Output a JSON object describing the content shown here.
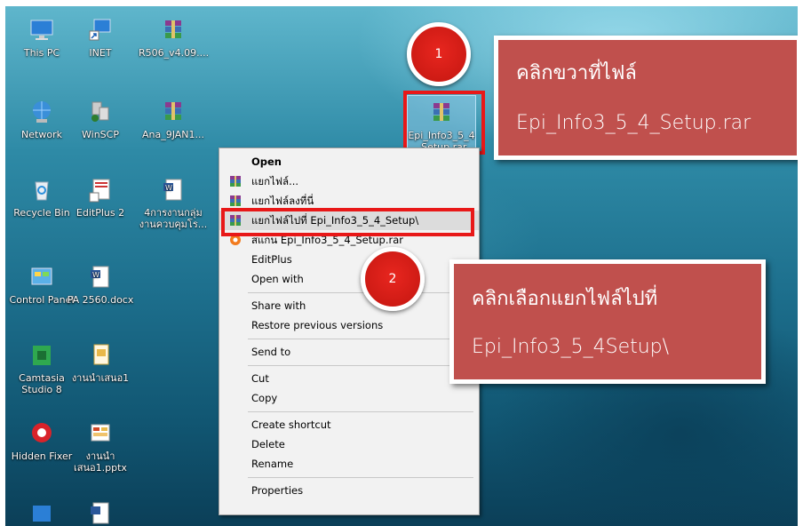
{
  "desktop": {
    "icons": [
      {
        "label": "This PC",
        "icon": "monitor-icon"
      },
      {
        "label": "INET",
        "icon": "network-shortcut-icon"
      },
      {
        "label": "R506_v4.09....",
        "icon": "winrar-archive-icon"
      },
      {
        "label": "Network",
        "icon": "network-globe-icon"
      },
      {
        "label": "WinSCP",
        "icon": "winscp-icon"
      },
      {
        "label": "Ana_9JAN1...",
        "icon": "winrar-archive-icon"
      },
      {
        "label": "Recycle Bin",
        "icon": "recycle-bin-icon"
      },
      {
        "label": "EditPlus 2",
        "icon": "editplus-icon"
      },
      {
        "label": "4การงานกลุ่ม งานควบคุมโร...",
        "icon": "word-document-icon"
      },
      {
        "label": "Control Panel",
        "icon": "control-panel-icon"
      },
      {
        "label": "PA 2560.docx",
        "icon": "word-document-icon"
      },
      {
        "label": "Camtasia Studio 8",
        "icon": "camtasia-icon"
      },
      {
        "label": "งานนำเสนอ1",
        "icon": "pptx-file-icon"
      },
      {
        "label": "Hidden Fixer",
        "icon": "hidden-fixer-icon"
      },
      {
        "label": "งานนำ เสนอ1.pptx",
        "icon": "pptx-file-icon"
      }
    ],
    "selected_file": {
      "label": "Epi_Info3_5_4_Setup.rar",
      "icon": "winrar-archive-icon"
    }
  },
  "context_menu": {
    "items": [
      {
        "label": "Open",
        "bold": true
      },
      {
        "label": "แยกไฟล์...",
        "icon": "winrar-icon"
      },
      {
        "label": "แยกไฟล์ลงที่นี่",
        "icon": "winrar-icon"
      },
      {
        "label": "แยกไฟล์ไปที่ Epi_Info3_5_4_Setup\\",
        "icon": "winrar-icon",
        "highlighted": true
      },
      {
        "label": "สแกน Epi_Info3_5_4_Setup.rar",
        "icon": "avast-icon"
      },
      {
        "label": "EditPlus"
      },
      {
        "label": "Open with",
        "submenu": true
      },
      {
        "label": "Share with",
        "submenu": true
      },
      {
        "label": "Restore previous versions"
      },
      {
        "label": "Send to",
        "submenu": true
      },
      {
        "label": "Cut"
      },
      {
        "label": "Copy"
      },
      {
        "label": "Create shortcut"
      },
      {
        "label": "Delete"
      },
      {
        "label": "Rename"
      },
      {
        "label": "Properties"
      }
    ]
  },
  "annotations": {
    "step1": {
      "number": "1",
      "line1": "คลิกขวาที่ไฟล์",
      "line2": "Epi_Info3_5_4_Setup.rar"
    },
    "step2": {
      "number": "2",
      "line1": "คลิกเลือกแยกไฟล์ไปที่",
      "line2": "Epi_Info3_5_4Setup\\"
    }
  },
  "colors": {
    "callout_bg": "#c0504d",
    "highlight_border": "#e81818",
    "badge_red": "#d41d16"
  }
}
